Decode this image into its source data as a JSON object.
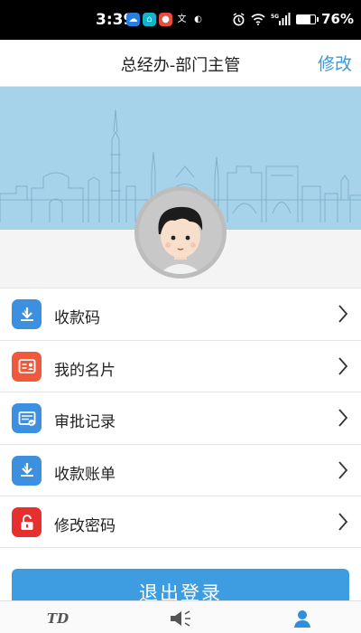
{
  "status": {
    "time": "3:39",
    "battery": "76%",
    "battery_level": 0.76,
    "network": "5G"
  },
  "header": {
    "title": "总经办-部门主管",
    "edit_label": "修改"
  },
  "menu": [
    {
      "label": "收款码",
      "icon": "collect-code-icon",
      "color": "#3d8fe0"
    },
    {
      "label": "我的名片",
      "icon": "business-card-icon",
      "color": "#ef5a3c"
    },
    {
      "label": "审批记录",
      "icon": "approval-record-icon",
      "color": "#3d8fe0"
    },
    {
      "label": "收款账单",
      "icon": "bill-icon",
      "color": "#3d8fe0"
    },
    {
      "label": "修改密码",
      "icon": "lock-icon",
      "color": "#e6302f"
    }
  ],
  "logout_label": "退出登录",
  "tabbar": {
    "home_label": "TD",
    "active_color": "#2e8fe0"
  }
}
